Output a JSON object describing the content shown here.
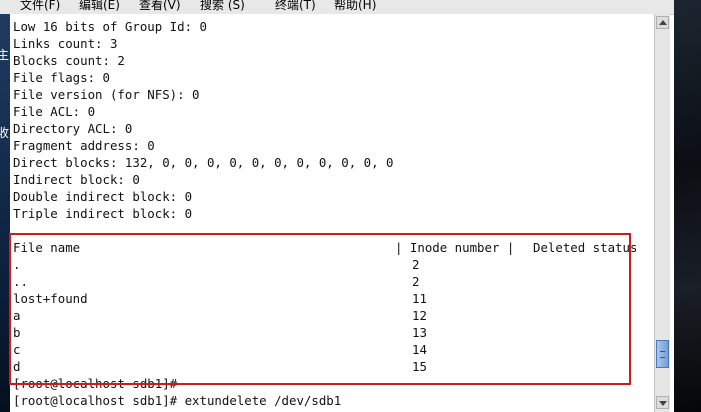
{
  "menu": [
    {
      "label": "文件(F)"
    },
    {
      "label": "编辑(E)"
    },
    {
      "label": "查看(V)"
    },
    {
      "label": "搜索 (S)"
    },
    {
      "label": "终端(T)"
    },
    {
      "label": "帮助(H)"
    }
  ],
  "desktop_left": [
    "主",
    "收"
  ],
  "inode_info": [
    "Low 16 bits of Group Id: 0",
    "Links count: 3",
    "Blocks count: 2",
    "File flags: 0",
    "File version (for NFS): 0",
    "File ACL: 0",
    "Directory ACL: 0",
    "Fragment address: 0",
    "Direct blocks: 132, 0, 0, 0, 0, 0, 0, 0, 0, 0, 0, 0",
    "Indirect block: 0",
    "Double indirect block: 0",
    "Triple indirect block: 0"
  ],
  "table": {
    "header": {
      "name": "File name",
      "inode": "| Inode number |",
      "status": "Deleted status"
    },
    "rows": [
      {
        "name": ".",
        "inode": "2"
      },
      {
        "name": "..",
        "inode": "2"
      },
      {
        "name": "lost+found",
        "inode": "11"
      },
      {
        "name": "a",
        "inode": "12"
      },
      {
        "name": "b",
        "inode": "13"
      },
      {
        "name": "c",
        "inode": "14"
      },
      {
        "name": "d",
        "inode": "15"
      }
    ]
  },
  "prompts": [
    "[root@localhost sdb1]#",
    "[root@localhost sdb1]# extundelete /dev/sdb1"
  ],
  "colors": {
    "highlight": "#d21a1a",
    "scroll_thumb": "#6f9fd8"
  }
}
